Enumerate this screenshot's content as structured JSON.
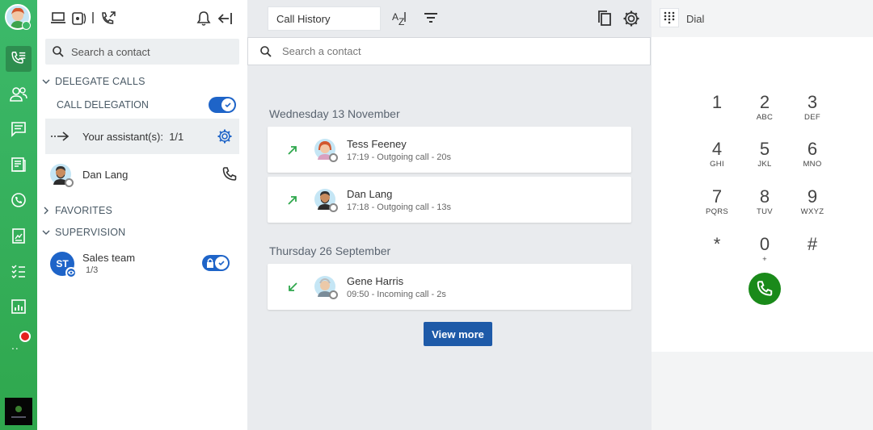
{
  "rail": {
    "items": [
      {
        "icon": "call-list-icon",
        "active": true
      },
      {
        "icon": "contacts-icon"
      },
      {
        "icon": "chat-icon"
      },
      {
        "icon": "directory-icon"
      },
      {
        "icon": "phone-settings-icon"
      },
      {
        "icon": "reports-icon"
      },
      {
        "icon": "tasks-icon"
      },
      {
        "icon": "analytics-icon"
      }
    ],
    "more_label": "..",
    "brand_color": "#34b05b"
  },
  "left_panel": {
    "search_placeholder": "Search a contact",
    "delegate_section": "DELEGATE CALLS",
    "call_delegation_label": "CALL DELEGATION",
    "assistant_label": "Your assistant(s):",
    "assistant_count": "1/1",
    "contact_name": "Dan Lang",
    "favorites_section": "FAVORITES",
    "supervision_section": "SUPERVISION",
    "team": {
      "initials": "ST",
      "name": "Sales team",
      "count": "1/3"
    }
  },
  "middle": {
    "view_select": "Call History",
    "search_placeholder": "Search a contact",
    "groups": [
      {
        "date": "Wednesday 13 November",
        "calls": [
          {
            "name": "Tess Feeney",
            "detail": "17:19 - Outgoing call - 20s",
            "direction": "outgoing"
          },
          {
            "name": "Dan Lang",
            "detail": "17:18 - Outgoing call - 13s",
            "direction": "outgoing"
          }
        ]
      },
      {
        "date": "Thursday 26 September",
        "calls": [
          {
            "name": "Gene Harris",
            "detail": "09:50 - Incoming call - 2s",
            "direction": "incoming"
          }
        ]
      }
    ],
    "view_more_label": "View more",
    "accent": "#1e5aa8"
  },
  "dialpad": {
    "title": "Dial",
    "keys": [
      {
        "d": "1",
        "l": ""
      },
      {
        "d": "2",
        "l": "ABC"
      },
      {
        "d": "3",
        "l": "DEF"
      },
      {
        "d": "4",
        "l": "GHI"
      },
      {
        "d": "5",
        "l": "JKL"
      },
      {
        "d": "6",
        "l": "MNO"
      },
      {
        "d": "7",
        "l": "PQRS"
      },
      {
        "d": "8",
        "l": "TUV"
      },
      {
        "d": "9",
        "l": "WXYZ"
      },
      {
        "d": "*",
        "l": ""
      },
      {
        "d": "0",
        "l": "+"
      },
      {
        "d": "#",
        "l": ""
      }
    ],
    "call_color": "#1a8a1a"
  }
}
